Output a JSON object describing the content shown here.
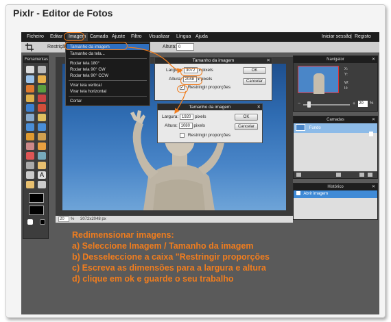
{
  "window": {
    "title": "Pixlr - Editor de Fotos"
  },
  "menubar": {
    "items": [
      "Ficheiro",
      "Editar",
      "Imagem",
      "Camada",
      "Ajuste",
      "Filtro",
      "Visualizar",
      "Língua",
      "Ajuda"
    ],
    "active_index": 2,
    "login": "Iniciar sessão",
    "separator": "|",
    "register": "Registo"
  },
  "optionsbar": {
    "restriction_label": "Restrição:",
    "height_label": "Altura:",
    "height_value": "0"
  },
  "tools_panel": {
    "title": "Ferramentas"
  },
  "image_menu": {
    "items": [
      "Tamanho da imagem",
      "Tamanho da tela...",
      "Rodar tela 180°",
      "Rodar tela 90° CW",
      "Rodar tela 90° CCW",
      "Virar tela vertical",
      "Virar tela horizontal",
      "Cortar"
    ],
    "highlight_index": 0
  },
  "dialog_before": {
    "title": "Tamanho da imagem",
    "width_label": "Largura:",
    "width_value": "3072",
    "height_label": "Altura:",
    "height_value": "2048",
    "unit": "pixels",
    "constrain_label": "Restringir proporções",
    "ok": "OK",
    "cancel": "Cancelar"
  },
  "dialog_after": {
    "title": "Tamanho da imagem",
    "width_label": "Largura:",
    "width_value": "1920",
    "height_label": "Altura:",
    "height_value": "1080",
    "unit": "pixels",
    "constrain_label": "Restringir proporções",
    "ok": "OK",
    "cancel": "Cancelar"
  },
  "canvas": {
    "zoom": "20",
    "zoom_unit": "%",
    "dimensions": "3072x2048 px"
  },
  "navigator": {
    "title": "Navigator",
    "x_label": "X:",
    "y_label": "Y:",
    "w_label": "W:",
    "h_label": "H:",
    "zoom": "20",
    "zoom_unit": "%"
  },
  "layers": {
    "title": "Camadas",
    "layer_name": "Fundo"
  },
  "history": {
    "title": "Histórico",
    "entry": "Abrir imagem"
  },
  "instructions": [
    "Redimensionar imagens:",
    "a) Seleccione Imagem / Tamanho da imagem",
    "b) Desseleccione a caixa \"Restringir proporções",
    "c) Escreva as dimensões para a largura e altura",
    "d) clique em ok e guarde o seu trabalho"
  ],
  "colors": {
    "accent": "#f07d1e",
    "menu_highlight": "#2f6fc0",
    "sky": "#2f6cb2"
  }
}
